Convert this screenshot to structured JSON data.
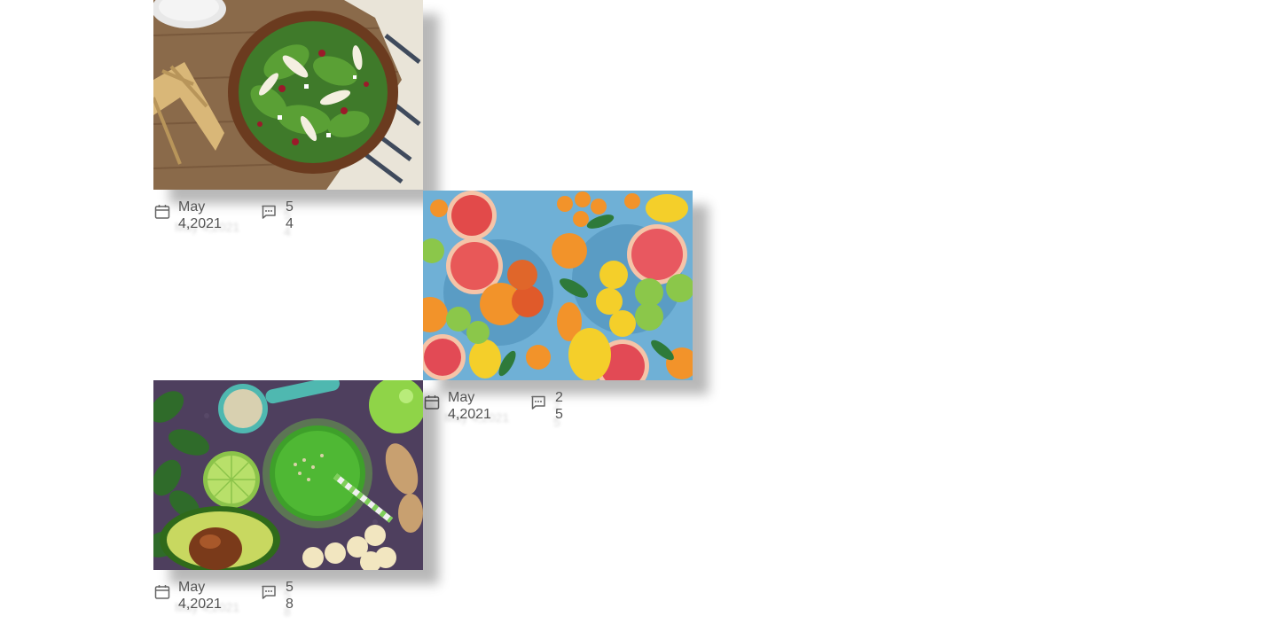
{
  "posts": [
    {
      "image": "spinach-apple-walnut-salad",
      "date": "May 4,2021",
      "comments": "54"
    },
    {
      "image": "citrus-fruits-platter",
      "date": "May 4,2021",
      "comments": "25"
    },
    {
      "image": "green-smoothie-ingredients",
      "date": "May 4,2021",
      "comments": "58"
    }
  ],
  "icons": {
    "date": "calendar-icon",
    "comments": "comment-icon"
  },
  "colors": {
    "text": "#555555",
    "shadow": "#8a8a8a"
  }
}
